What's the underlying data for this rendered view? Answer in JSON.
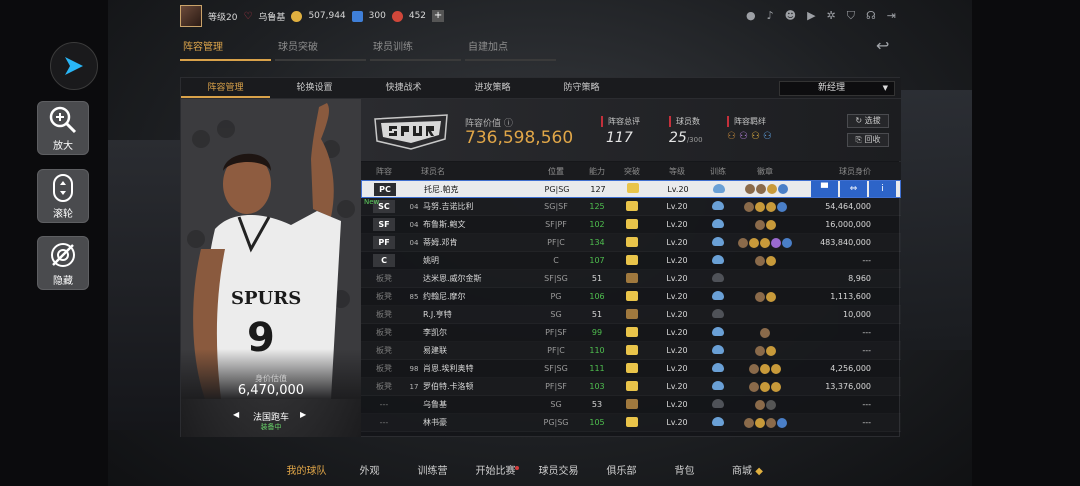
{
  "sidebar": {
    "zoom_label": "放大",
    "scroll_label": "滚轮",
    "hide_label": "隐藏"
  },
  "topbar": {
    "level": "等级20",
    "username": "乌鲁基",
    "coins": "507,944",
    "gems": "300",
    "points": "452"
  },
  "subnav": {
    "tabs": [
      "阵容管理",
      "球员突破",
      "球员训练",
      "自建加点"
    ]
  },
  "panel_tabs": [
    "阵容管理",
    "轮换设置",
    "快捷战术",
    "进攻策略",
    "防守策略"
  ],
  "coach_select": "新经理",
  "hero": {
    "value_label": "身价估值",
    "value": "6,470,000",
    "car": "法国跑车",
    "car_status": "装备中"
  },
  "team": {
    "lineup_value_label": "阵容价值",
    "lineup_value": "736,598,560",
    "total_rating_label": "阵容总评",
    "total_rating": "117",
    "player_count_label": "球员数",
    "player_count": "25",
    "player_count_max": "/300",
    "chemistry_label": "阵容羁绊",
    "select_btn": "选拔",
    "recycle_btn": "回收"
  },
  "table": {
    "headers": [
      "阵容",
      "球员名",
      "位置",
      "能力",
      "突破",
      "等级",
      "训练",
      "徽章",
      "球员身价"
    ],
    "rows": [
      {
        "slot": "PC",
        "num": "",
        "name": "托尼.帕克",
        "pos": "PG|SG",
        "ability": "127",
        "ability_green": false,
        "level": "Lv.20",
        "value": ""
      },
      {
        "slot": "SC",
        "num": "04",
        "name": "马努.吉诺比利",
        "pos": "SG|SF",
        "ability": "125",
        "ability_green": true,
        "level": "Lv.20",
        "value": "54,464,000",
        "new": "New"
      },
      {
        "slot": "SF",
        "num": "04",
        "name": "布鲁斯.鲍文",
        "pos": "SF|PF",
        "ability": "102",
        "ability_green": true,
        "level": "Lv.20",
        "value": "16,000,000"
      },
      {
        "slot": "PF",
        "num": "04",
        "name": "蒂姆.邓肯",
        "pos": "PF|C",
        "ability": "134",
        "ability_green": true,
        "level": "Lv.20",
        "value": "483,840,000"
      },
      {
        "slot": "C",
        "num": "",
        "name": "姚明",
        "pos": "C",
        "ability": "107",
        "ability_green": true,
        "level": "Lv.20",
        "value": "---"
      },
      {
        "slot": "板凳",
        "num": "",
        "name": "达米恩.威尔金斯",
        "pos": "SF|SG",
        "ability": "51",
        "ability_green": false,
        "level": "Lv.20",
        "value": "8,960"
      },
      {
        "slot": "板凳",
        "num": "85",
        "name": "约翰尼.摩尔",
        "pos": "PG",
        "ability": "106",
        "ability_green": true,
        "level": "Lv.20",
        "value": "1,113,600"
      },
      {
        "slot": "板凳",
        "num": "",
        "name": "R.J.亨特",
        "pos": "SG",
        "ability": "51",
        "ability_green": false,
        "level": "Lv.20",
        "value": "10,000"
      },
      {
        "slot": "板凳",
        "num": "",
        "name": "李凯尔",
        "pos": "PF|SF",
        "ability": "99",
        "ability_green": true,
        "level": "Lv.20",
        "value": "---"
      },
      {
        "slot": "板凳",
        "num": "",
        "name": "易建联",
        "pos": "PF|C",
        "ability": "110",
        "ability_green": true,
        "level": "Lv.20",
        "value": "---"
      },
      {
        "slot": "板凳",
        "num": "98",
        "name": "肖恩.埃利奥特",
        "pos": "SF|SG",
        "ability": "111",
        "ability_green": true,
        "level": "Lv.20",
        "value": "4,256,000"
      },
      {
        "slot": "板凳",
        "num": "17",
        "name": "罗伯特.卡洛顿",
        "pos": "PF|SF",
        "ability": "103",
        "ability_green": true,
        "level": "Lv.20",
        "value": "13,376,000"
      },
      {
        "slot": "---",
        "num": "",
        "name": "乌鲁基",
        "pos": "SG",
        "ability": "53",
        "ability_green": false,
        "level": "Lv.20",
        "value": "---"
      },
      {
        "slot": "---",
        "num": "",
        "name": "林书豪",
        "pos": "PG|SG",
        "ability": "105",
        "ability_green": true,
        "level": "Lv.20",
        "value": "---"
      }
    ]
  },
  "bottomnav": [
    "我的球队",
    "外观",
    "训练营",
    "开始比赛",
    "球员交易",
    "俱乐部",
    "背包",
    "商城"
  ],
  "colors": {
    "accent": "#e0a648",
    "selected_outline": "#3f6fd0",
    "green": "#4fbf4f"
  }
}
